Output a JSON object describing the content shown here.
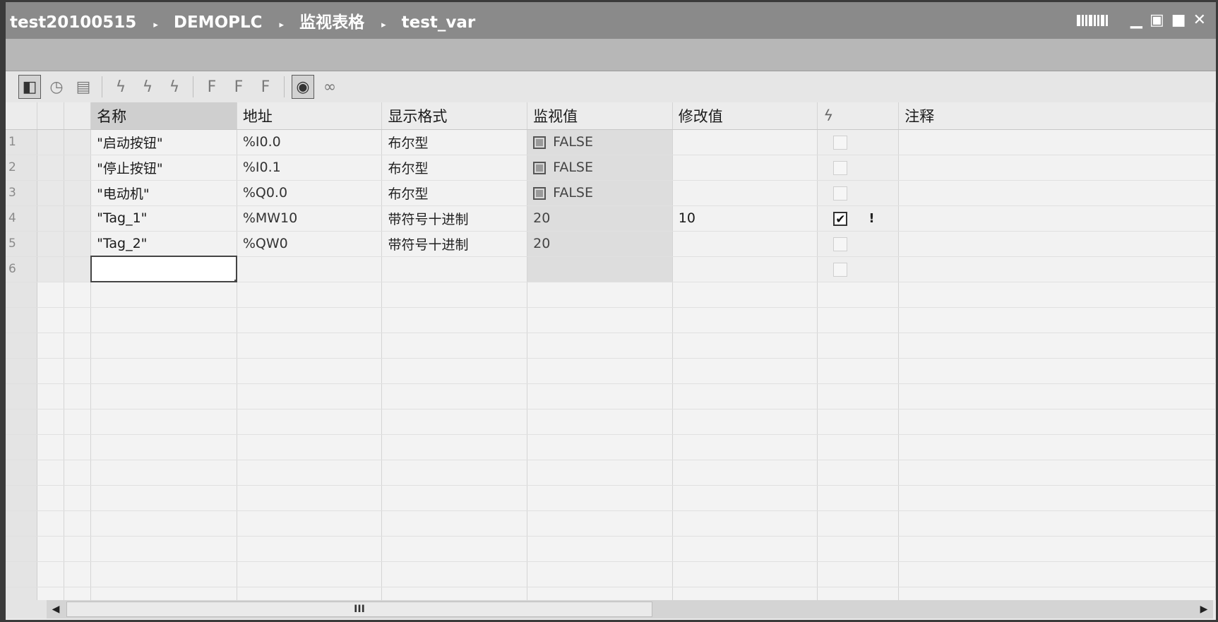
{
  "breadcrumb": {
    "items": [
      "test20100515",
      "DEMOPLC",
      "监视表格",
      "test_var"
    ],
    "separator": "▸"
  },
  "window_controls": {
    "minimize": "▁",
    "restore": "▣",
    "maximize": "■",
    "close": "✕"
  },
  "toolbar": {
    "buttons": [
      {
        "name": "monitor-all-icon",
        "glyph": "◧"
      },
      {
        "name": "monitor-once-icon",
        "glyph": "◷"
      },
      {
        "name": "show-force-icon",
        "glyph": "▤"
      },
      {
        "name": "modify-now-icon",
        "glyph": "ϟ"
      },
      {
        "name": "modify-trigger-icon",
        "glyph": "ϟ"
      },
      {
        "name": "modify-all-icon",
        "glyph": "ϟ"
      },
      {
        "name": "force-icon",
        "glyph": "F"
      },
      {
        "name": "stop-force-icon",
        "glyph": "F"
      },
      {
        "name": "force-all-icon",
        "glyph": "F"
      },
      {
        "name": "monitor-start-icon",
        "glyph": "◉"
      },
      {
        "name": "monitor-glasses-icon",
        "glyph": "∞"
      }
    ]
  },
  "table": {
    "columns": [
      "名称",
      "地址",
      "显示格式",
      "监视值",
      "修改值",
      "",
      "注释"
    ],
    "force_header_icon": "ϟ",
    "rows": [
      {
        "num": "1",
        "name": "\"启动按钮\"",
        "address": "%I0.0",
        "format": "布尔型",
        "monitor": "FALSE",
        "bool": true,
        "modify": "",
        "checked": false,
        "warn": false,
        "comment": ""
      },
      {
        "num": "2",
        "name": "\"停止按钮\"",
        "address": "%I0.1",
        "format": "布尔型",
        "monitor": "FALSE",
        "bool": true,
        "modify": "",
        "checked": false,
        "warn": false,
        "comment": ""
      },
      {
        "num": "3",
        "name": "\"电动机\"",
        "address": "%Q0.0",
        "format": "布尔型",
        "monitor": "FALSE",
        "bool": true,
        "modify": "",
        "checked": false,
        "warn": false,
        "comment": ""
      },
      {
        "num": "4",
        "name": "\"Tag_1\"",
        "address": "%MW10",
        "format": "带符号十进制",
        "monitor": "20",
        "bool": false,
        "modify": "10",
        "checked": true,
        "warn": true,
        "comment": ""
      },
      {
        "num": "5",
        "name": "\"Tag_2\"",
        "address": "%QW0",
        "format": "带符号十进制",
        "monitor": "20",
        "bool": false,
        "modify": "",
        "checked": false,
        "warn": false,
        "comment": ""
      },
      {
        "num": "6",
        "name": "",
        "address": "",
        "format": "",
        "monitor": "",
        "bool": false,
        "modify": "",
        "checked": false,
        "warn": false,
        "comment": "",
        "editing": true
      }
    ],
    "checkmark": "✔",
    "warning_glyph": "!"
  },
  "scrollbar": {
    "left_arrow": "◀",
    "right_arrow": "▶",
    "thumb_grip": "III"
  }
}
